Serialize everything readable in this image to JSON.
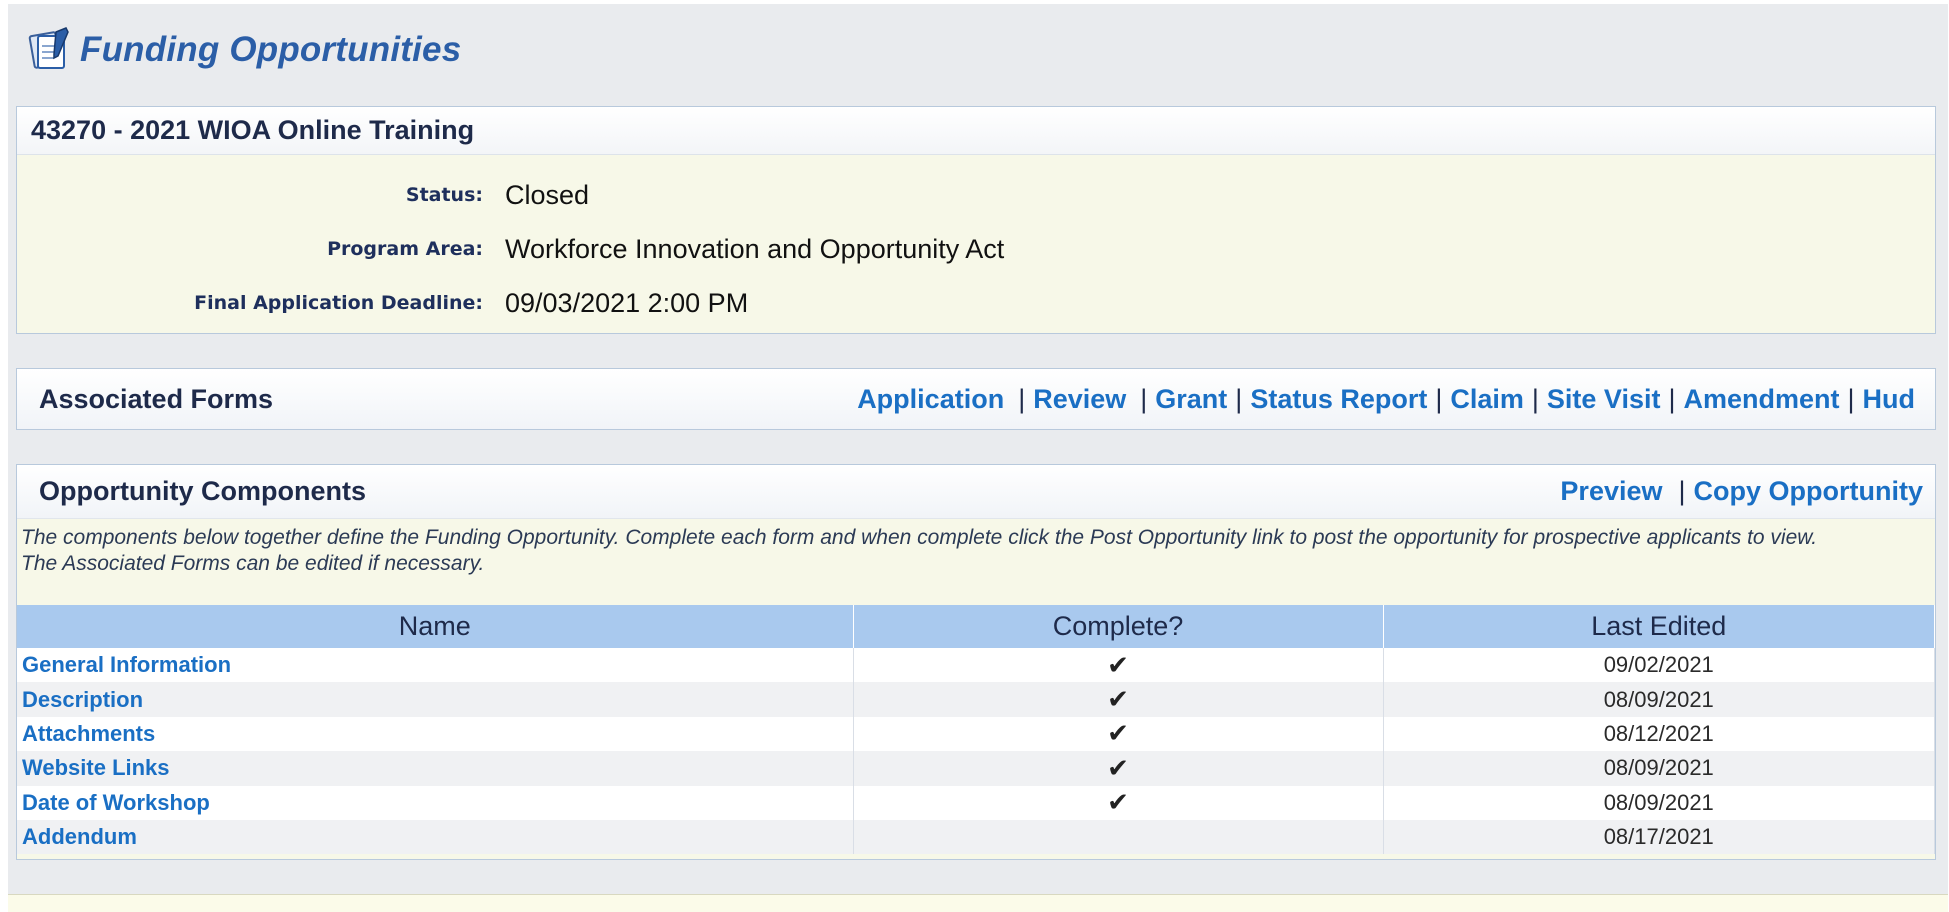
{
  "page": {
    "title": "Funding Opportunities",
    "icon": "documents-edit-icon"
  },
  "opportunity": {
    "heading": "43270 - 2021 WIOA Online Training",
    "fields": [
      {
        "label": "Status:",
        "value": "Closed"
      },
      {
        "label": "Program Area:",
        "value": "Workforce Innovation and Opportunity Act"
      },
      {
        "label": "Final Application Deadline:",
        "value": "09/03/2021 2:00 PM"
      }
    ]
  },
  "associated_forms": {
    "title": "Associated Forms",
    "links": [
      "Application",
      "Review",
      "Grant",
      "Status Report",
      "Claim",
      "Site Visit",
      "Amendment",
      "Hud"
    ]
  },
  "components": {
    "title": "Opportunity Components",
    "actions": [
      "Preview",
      "Copy Opportunity"
    ],
    "description_line1": "The components below together define the Funding Opportunity. Complete each form and when complete click the Post Opportunity link to post the opportunity for prospective applicants to view.",
    "description_line2": "The Associated Forms can be edited if necessary.",
    "columns": [
      "Name",
      "Complete?",
      "Last Edited"
    ],
    "rows": [
      {
        "name": "General Information",
        "complete": "✔",
        "last_edited": "09/02/2021"
      },
      {
        "name": "Description",
        "complete": "✔",
        "last_edited": "08/09/2021"
      },
      {
        "name": "Attachments",
        "complete": "✔",
        "last_edited": "08/12/2021"
      },
      {
        "name": "Website Links",
        "complete": "✔",
        "last_edited": "08/09/2021"
      },
      {
        "name": "Date of Workshop",
        "complete": "✔",
        "last_edited": "08/09/2021"
      },
      {
        "name": "Addendum",
        "complete": "",
        "last_edited": "08/17/2021"
      }
    ]
  },
  "colors": {
    "link": "#1a6fc4",
    "table_header": "#a9c9ee",
    "panel": "#f7f8e8",
    "title": "#2b5ea7"
  }
}
